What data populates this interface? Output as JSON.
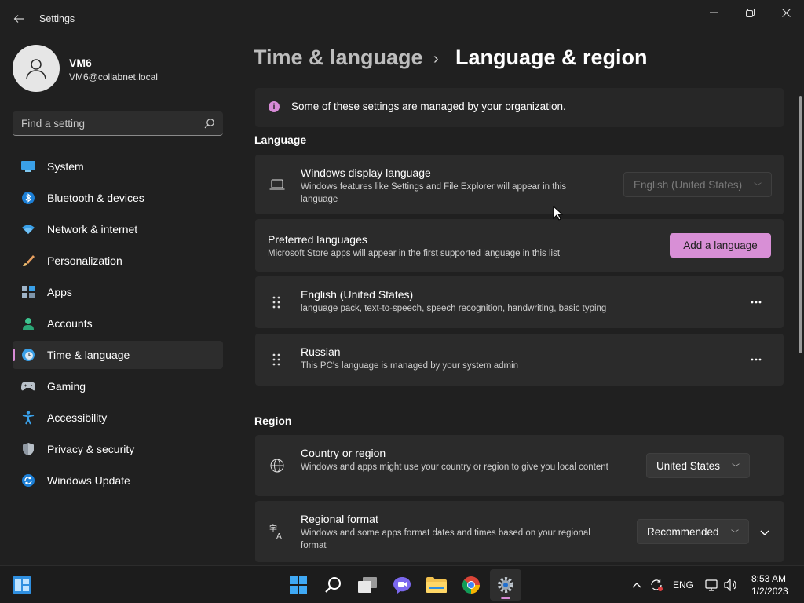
{
  "window": {
    "title": "Settings"
  },
  "profile": {
    "name": "VM6",
    "email": "VM6@collabnet.local"
  },
  "search": {
    "placeholder": "Find a setting"
  },
  "sidebar": {
    "items": [
      {
        "label": "System",
        "icon": "system-icon"
      },
      {
        "label": "Bluetooth & devices",
        "icon": "bluetooth-icon"
      },
      {
        "label": "Network & internet",
        "icon": "wifi-icon"
      },
      {
        "label": "Personalization",
        "icon": "brush-icon"
      },
      {
        "label": "Apps",
        "icon": "apps-icon"
      },
      {
        "label": "Accounts",
        "icon": "accounts-icon"
      },
      {
        "label": "Time & language",
        "icon": "clock-globe-icon",
        "selected": true
      },
      {
        "label": "Gaming",
        "icon": "gamepad-icon"
      },
      {
        "label": "Accessibility",
        "icon": "accessibility-icon"
      },
      {
        "label": "Privacy & security",
        "icon": "shield-icon"
      },
      {
        "label": "Windows Update",
        "icon": "update-icon"
      }
    ]
  },
  "breadcrumb": {
    "parent": "Time & language",
    "separator": "›",
    "current": "Language & region"
  },
  "info_bar": {
    "text": "Some of these settings are managed by your organization."
  },
  "language_section": {
    "title": "Language",
    "display_language": {
      "title": "Windows display language",
      "description": "Windows features like Settings and File Explorer will appear in this language",
      "value": "English (United States)"
    },
    "preferred": {
      "title": "Preferred languages",
      "description": "Microsoft Store apps will appear in the first supported language in this list",
      "add_button": "Add a language"
    },
    "languages": [
      {
        "name": "English (United States)",
        "description": "language pack, text-to-speech, speech recognition, handwriting, basic typing"
      },
      {
        "name": "Russian",
        "description": "This PC's language is managed by your system admin"
      }
    ]
  },
  "region_section": {
    "title": "Region",
    "country": {
      "title": "Country or region",
      "description": "Windows and apps might use your country or region to give you local content",
      "value": "United States"
    },
    "format": {
      "title": "Regional format",
      "description": "Windows and some apps format dates and times based on your regional format",
      "value": "Recommended"
    }
  },
  "taskbar": {
    "apps": [
      "start-icon",
      "search-icon",
      "task-view-icon",
      "chat-icon",
      "file-explorer-icon",
      "chrome-icon",
      "settings-icon"
    ],
    "language": "ENG",
    "time": "8:53 AM",
    "date": "1/2/2023"
  },
  "colors": {
    "accent": "#d88fd6",
    "background": "#202020",
    "card": "#2b2b2b"
  }
}
